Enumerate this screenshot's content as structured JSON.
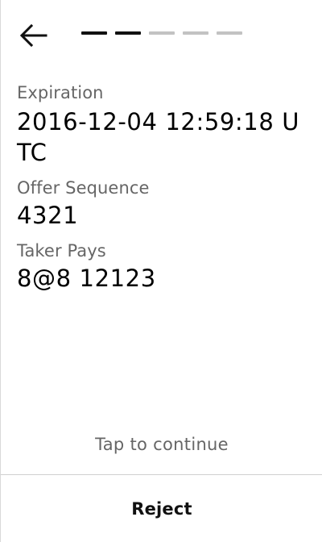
{
  "header": {
    "back_icon": "arrow-left-icon",
    "progress": {
      "total_steps": 5,
      "completed_steps": 2,
      "active_color": "#111111",
      "inactive_color": "#c2c2c2"
    }
  },
  "fields": [
    {
      "label": "Expiration",
      "value": "2016-12-04 12:59:18 UTC"
    },
    {
      "label": "Offer Sequence",
      "value": "4321"
    },
    {
      "label": "Taker Pays",
      "value": "8@8 12123"
    }
  ],
  "hint": "Tap to continue",
  "footer": {
    "reject_label": "Reject"
  }
}
